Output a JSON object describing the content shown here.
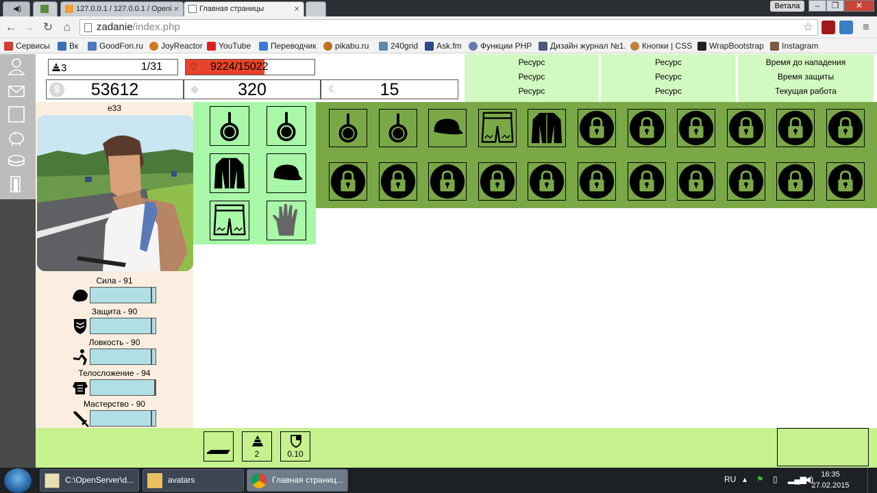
{
  "browser": {
    "tabs": [
      {
        "label": ""
      },
      {
        "label": "127.0.0.1 / 127.0.0.1 / Openi"
      },
      {
        "label": "Главная страницы"
      },
      {
        "label": ""
      }
    ],
    "user_chip": "Ветала",
    "url_host": "zadanie",
    "url_path": "/index.php",
    "bookmarks": [
      {
        "label": "Сервисы",
        "color": "#d04030"
      },
      {
        "label": "Вк",
        "color": "#3a6fb0"
      },
      {
        "label": "GoodFon.ru",
        "color": "#4a78b8"
      },
      {
        "label": "JoyReactor",
        "color": "#d07a20"
      },
      {
        "label": "YouTube",
        "color": "#e02020"
      },
      {
        "label": "Переводчик",
        "color": "#3b7bd8"
      },
      {
        "label": "pikabu.ru",
        "color": "#c07020"
      },
      {
        "label": "240grid",
        "color": "#5a8ab0"
      },
      {
        "label": "Ask.fm",
        "color": "#2a4a8a"
      },
      {
        "label": "Функции PHP",
        "color": "#6a7aa8"
      },
      {
        "label": "Дизайн журнал №1.",
        "color": "#4a5a7a"
      },
      {
        "label": "Кнопки | CSS",
        "color": "#c08040"
      },
      {
        "label": "WrapBootstrap",
        "color": "#222222"
      },
      {
        "label": "Instagram",
        "color": "#7a5a40"
      }
    ]
  },
  "header": {
    "level": "3",
    "level_progress": "1/31",
    "hp": "9224/15022",
    "hp_fraction": 0.614,
    "currencies": [
      {
        "icon": "$",
        "value": "53612"
      },
      {
        "icon": "◆",
        "value": "320"
      },
      {
        "icon": "€",
        "value": "15"
      }
    ],
    "resources": [
      [
        "Ресурс",
        "Ресурс",
        "Ресурс"
      ],
      [
        "Ресурс",
        "Ресурс",
        "Ресурс"
      ],
      [
        "Время до нападения",
        "Время защиты",
        "Текущая работа"
      ]
    ]
  },
  "character": {
    "name": "e33",
    "stats": [
      {
        "label": "Сила - 91",
        "icon": "biceps-icon",
        "fill": 0.95
      },
      {
        "label": "Защита - 90",
        "icon": "shield-icon",
        "fill": 0.95
      },
      {
        "label": "Ловкость - 90",
        "icon": "kick-icon",
        "fill": 0.95
      },
      {
        "label": "Телосложение - 94",
        "icon": "torso-icon",
        "fill": 1.0
      },
      {
        "label": "Мастерство - 90",
        "icon": "sword-icon",
        "fill": 0.95
      }
    ]
  },
  "equipment": [
    "pan-icon",
    "pan-icon",
    "jacket-icon",
    "cap-icon",
    "shorts-icon",
    "glove-icon"
  ],
  "inventory": {
    "row1": [
      "pan-icon",
      "pan-icon",
      "cap-icon",
      "shorts-icon",
      "jacket-icon",
      "lock-icon",
      "lock-icon",
      "lock-icon",
      "lock-icon",
      "lock-icon",
      "lock-icon"
    ],
    "row2": [
      "lock-icon",
      "lock-icon",
      "lock-icon",
      "lock-icon",
      "lock-icon",
      "lock-icon",
      "lock-icon",
      "lock-icon",
      "lock-icon",
      "lock-icon",
      "lock-icon"
    ]
  },
  "footer": {
    "boxes": [
      {
        "icon": "ground-icon",
        "value": ""
      },
      {
        "icon": "level-icon",
        "value": "2"
      },
      {
        "icon": "defense-icon",
        "value": "0.10"
      }
    ]
  },
  "taskbar": {
    "tasks": [
      {
        "label": "C:\\OpenServer\\d..."
      },
      {
        "label": "avatars"
      },
      {
        "label": "Главная страниц..."
      }
    ],
    "lang": "RU",
    "time": "16:35",
    "date": "27.02.2015"
  }
}
